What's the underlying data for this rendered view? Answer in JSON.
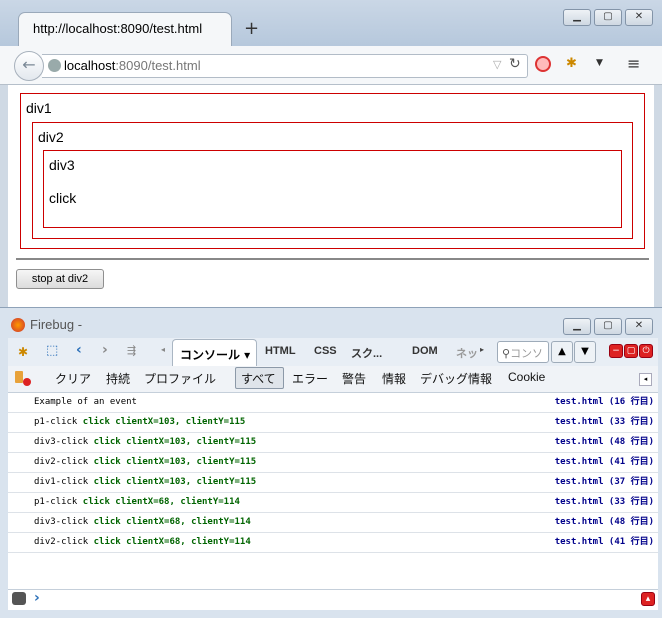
{
  "browser": {
    "tab_title": "http://localhost:8090/test.html",
    "new_tab": "+",
    "url_host": "localhost",
    "url_rest": ":8090/test.html"
  },
  "page": {
    "div1": "div1",
    "div2": "div2",
    "div3": "div3",
    "p1": "click",
    "button": "stop at div2"
  },
  "firebug": {
    "title": "Firebug -",
    "tabs": [
      "コンソール ▾",
      "HTML",
      "CSS",
      "スク...",
      "DOM",
      "ネッ"
    ],
    "search_placeholder": "コンソ",
    "toolbar": [
      "クリア",
      "持続",
      "プロファイル",
      "すべて",
      "エラー",
      "警告",
      "情報",
      "デバッグ情報",
      "Cookie"
    ],
    "log": [
      {
        "label": "Example of an event",
        "detail": "",
        "source": "test.html (16 行目)"
      },
      {
        "label": "p1-click",
        "detail": "click clientX=103, clientY=115",
        "source": "test.html (33 行目)"
      },
      {
        "label": "div3-click",
        "detail": "click clientX=103, clientY=115",
        "source": "test.html (48 行目)"
      },
      {
        "label": "div2-click",
        "detail": "click clientX=103, clientY=115",
        "source": "test.html (41 行目)"
      },
      {
        "label": "div1-click",
        "detail": "click clientX=103, clientY=115",
        "source": "test.html (37 行目)"
      },
      {
        "label": "p1-click",
        "detail": "click clientX=68, clientY=114",
        "source": "test.html (33 行目)"
      },
      {
        "label": "div3-click",
        "detail": "click clientX=68, clientY=114",
        "source": "test.html (48 行目)"
      },
      {
        "label": "div2-click",
        "detail": "click clientX=68, clientY=114",
        "source": "test.html (41 行目)"
      }
    ],
    "prompt": "›"
  },
  "colors": {
    "box_border": "#cc0000",
    "log_green": "#006400",
    "log_link": "#00008b"
  }
}
